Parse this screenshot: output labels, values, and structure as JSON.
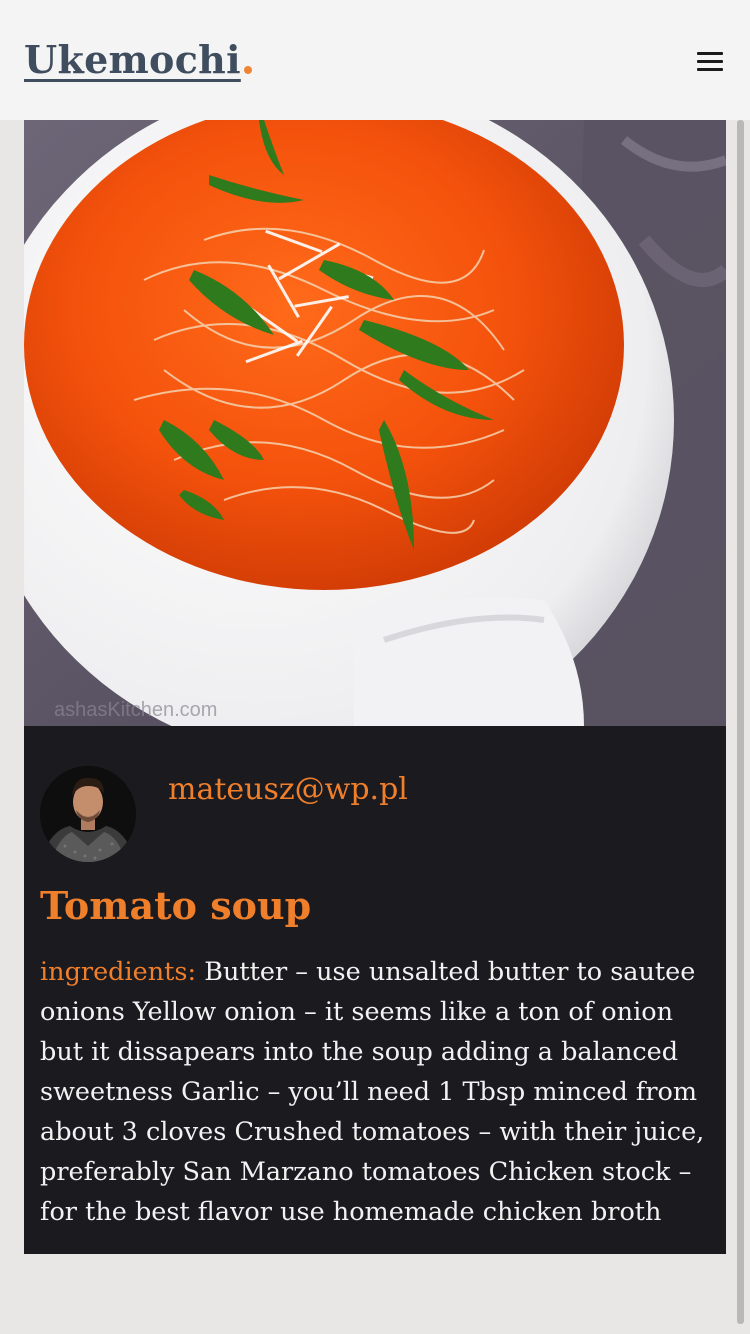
{
  "header": {
    "logo_text": "Ukemochi",
    "logo_dot_color": "#f08436",
    "menu_icon": "hamburger-icon"
  },
  "recipe": {
    "image_alt": "Tomato soup in a white bowl topped with basil and parmesan",
    "image_watermark": "ashasKitchen.com",
    "author_email": "mateusz@wp.pl",
    "title": "Tomato soup",
    "ingredients_label": "ingredients:",
    "ingredients_text": " Butter – use unsalted butter to sautee onions Yellow onion – it seems like a ton of onion but it dissapears into the soup adding a balanced sweetness Garlic – you’ll need 1 Tbsp minced from about 3 cloves Crushed tomatoes – with their juice, preferably San Marzano tomatoes Chicken stock – for the best flavor use homemade chicken broth"
  },
  "colors": {
    "accent": "#f07f2c",
    "card_bg": "#1b1a1e",
    "logo": "#3f4d5e"
  }
}
